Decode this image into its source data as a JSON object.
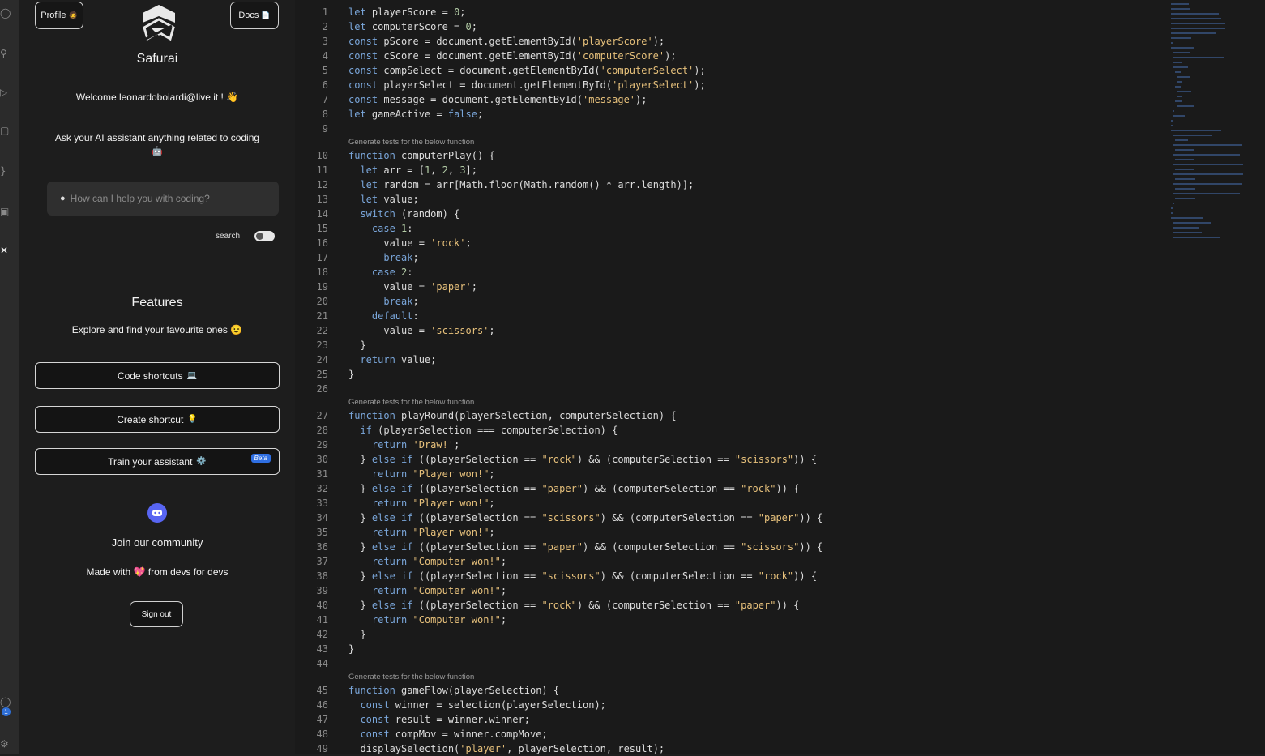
{
  "activity_bar": {
    "icons": [
      "files-icon",
      "search-icon",
      "run-icon",
      "extensions-icon",
      "brackets-icon",
      "debug-icon",
      "safurai-icon",
      "account-icon",
      "settings-icon"
    ],
    "badge": "1"
  },
  "panel": {
    "profile_label": "Profile",
    "profile_emoji": "🧔",
    "docs_label": "Docs",
    "docs_emoji": "📄",
    "brand": "Safurai",
    "welcome": "Welcome leonardoboiardi@live.it ! 👋",
    "ask_prompt": "Ask your AI assistant anything related to coding",
    "ask_emoji": "🤖",
    "search_placeholder": "How can I help you with coding?",
    "search_toggle_label": "search",
    "features_title": "Features",
    "features_subtitle": "Explore and find your favourite ones 😉",
    "buttons": [
      {
        "label": "Code shortcuts",
        "emoji": "💻"
      },
      {
        "label": "Create shortcut",
        "emoji": "💡"
      },
      {
        "label": "Train your assistant",
        "emoji": "⚙️",
        "badge": "Beta"
      }
    ],
    "community": "Join our community",
    "made_with": "Made with 💖 from devs for devs",
    "sign_out": "Sign out"
  },
  "editor": {
    "codelens": "Generate tests for the below function",
    "lines": [
      "let playerScore = 0;",
      "let computerScore = 0;",
      "const pScore = document.getElementById('playerScore');",
      "const cScore = document.getElementById('computerScore');",
      "const compSelect = document.getElementById('computerSelect');",
      "const playerSelect = document.getElementById('playerSelect');",
      "const message = document.getElementById('message');",
      "let gameActive = false;",
      "",
      "function computerPlay() {",
      "  let arr = [1, 2, 3];",
      "  let random = arr[Math.floor(Math.random() * arr.length)];",
      "  let value;",
      "  switch (random) {",
      "    case 1:",
      "      value = 'rock';",
      "      break;",
      "    case 2:",
      "      value = 'paper';",
      "      break;",
      "    default:",
      "      value = 'scissors';",
      "  }",
      "  return value;",
      "}",
      "",
      "function playRound(playerSelection, computerSelection) {",
      "  if (playerSelection === computerSelection) {",
      "    return 'Draw!';",
      "  } else if ((playerSelection == \"rock\") && (computerSelection == \"scissors\")) {",
      "    return \"Player won!\";",
      "  } else if ((playerSelection == \"paper\") && (computerSelection == \"rock\")) {",
      "    return \"Player won!\";",
      "  } else if ((playerSelection == \"scissors\") && (computerSelection == \"paper\")) {",
      "    return \"Player won!\";",
      "  } else if ((playerSelection == \"paper\") && (computerSelection == \"scissors\")) {",
      "    return \"Computer won!\";",
      "  } else if ((playerSelection == \"scissors\") && (computerSelection == \"rock\")) {",
      "    return \"Computer won!\";",
      "  } else if ((playerSelection == \"rock\") && (computerSelection == \"paper\")) {",
      "    return \"Computer won!\";",
      "  }",
      "}",
      "",
      "function gameFlow(playerSelection) {",
      "  const winner = selection(playerSelection);",
      "  const result = winner.winner;",
      "  const compMov = winner.compMove;",
      "  displaySelection('player', playerSelection, result);"
    ],
    "codelens_before_lines": [
      10,
      27,
      45
    ]
  }
}
